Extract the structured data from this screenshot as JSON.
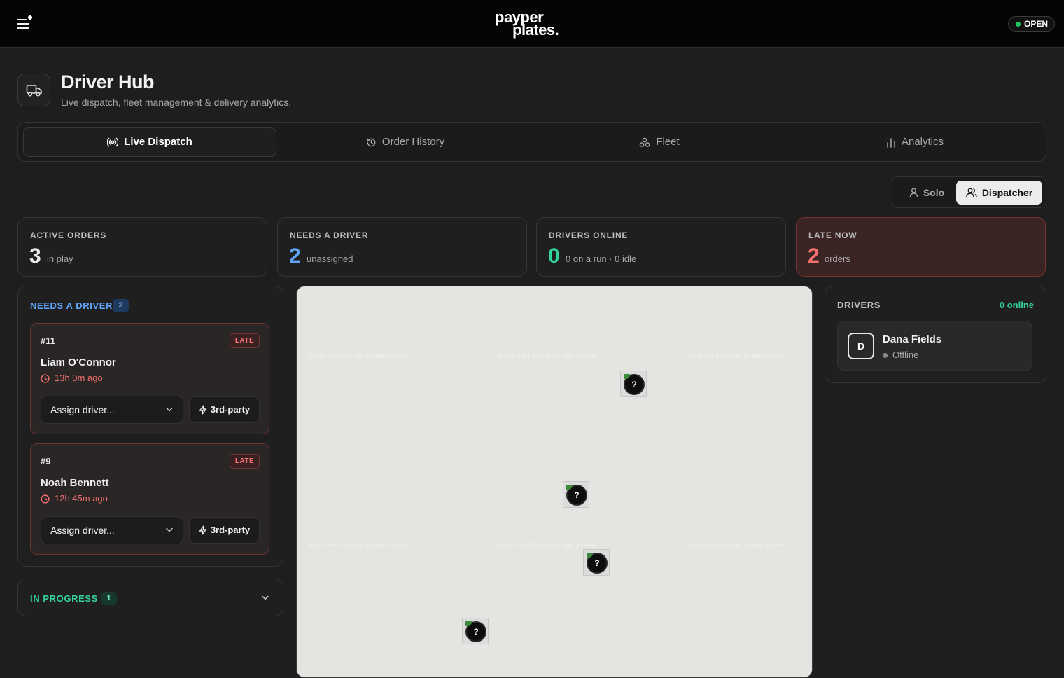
{
  "brand": {
    "line1": "payper",
    "line2": "plates."
  },
  "status_badge": "OPEN",
  "header": {
    "title": "Driver Hub",
    "subtitle": "Live dispatch, fleet management & delivery analytics."
  },
  "tabs": [
    {
      "label": "Live Dispatch",
      "icon": "broadcast-icon",
      "active": true
    },
    {
      "label": "Order History",
      "icon": "history-icon",
      "active": false
    },
    {
      "label": "Fleet",
      "icon": "fleet-icon",
      "active": false
    },
    {
      "label": "Analytics",
      "icon": "bar-chart-icon",
      "active": false
    }
  ],
  "modes": [
    {
      "label": "Solo",
      "icon": "user-icon",
      "active": false
    },
    {
      "label": "Dispatcher",
      "icon": "users-icon",
      "active": true
    }
  ],
  "stats": [
    {
      "label": "ACTIVE ORDERS",
      "value": "3",
      "caption": "in play",
      "color": "#e8e8e8"
    },
    {
      "label": "NEEDS A DRIVER",
      "value": "2",
      "caption": "unassigned",
      "color": "#60a5fa"
    },
    {
      "label": "DRIVERS ONLINE",
      "value": "0",
      "caption": "0 on a run · 0 idle",
      "color": "#34d399"
    },
    {
      "label": "LATE NOW",
      "value": "2",
      "caption": "orders",
      "color": "#f87171"
    }
  ],
  "needs_driver": {
    "title": "NEEDS A DRIVER",
    "count": "2",
    "orders": [
      {
        "number": "#11",
        "tag": "LATE",
        "customer": "Liam O'Connor",
        "elapsed": "13h 0m ago",
        "assign_placeholder": "Assign driver...",
        "third_party_label": "3rd-party"
      },
      {
        "number": "#9",
        "tag": "LATE",
        "customer": "Noah Bennett",
        "elapsed": "12h 45m ago",
        "assign_placeholder": "Assign driver...",
        "third_party_label": "3rd-party"
      }
    ]
  },
  "in_progress": {
    "title": "IN PROGRESS",
    "count": "1"
  },
  "map": {
    "tile_message": "Sorry, we have no imagery here.",
    "marker_glyph": "?"
  },
  "drivers": {
    "title": "DRIVERS",
    "online_summary": "0 online",
    "list": [
      {
        "initial": "D",
        "name": "Dana Fields",
        "status": "Offline"
      }
    ]
  },
  "colors": {
    "accent_blue": "#60a5fa",
    "accent_green": "#34d399",
    "late_red": "#f87171",
    "open_green": "#22c55e"
  }
}
